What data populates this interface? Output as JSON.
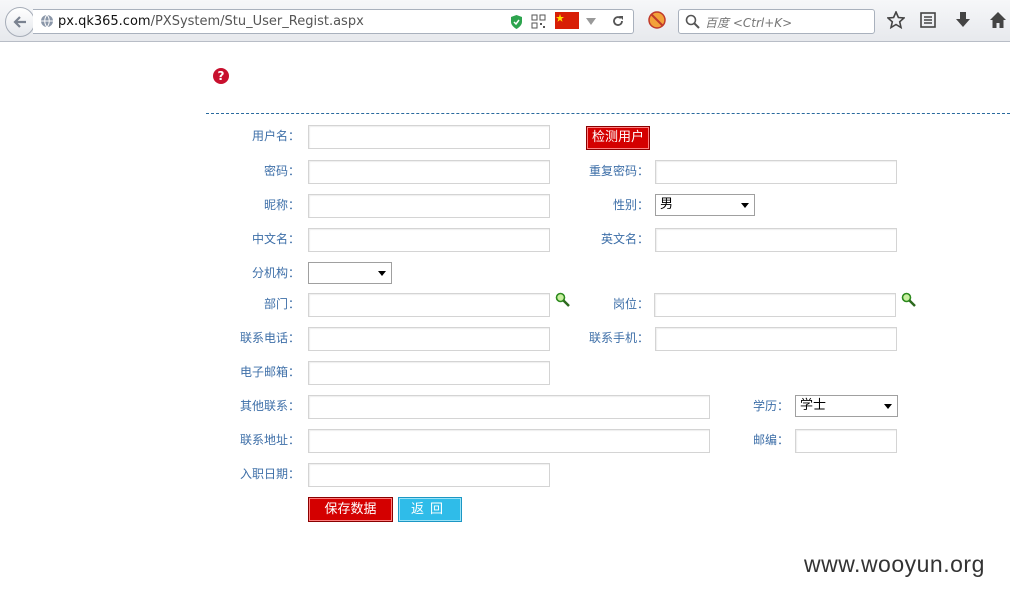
{
  "browser": {
    "url_host": "px.qk365.com",
    "url_path": "/PXSystem/Stu_User_Regist.aspx",
    "search_placeholder": "百度 <Ctrl+K>"
  },
  "form": {
    "username_label": "用户名：",
    "check_user_button": "检测用户",
    "password_label": "密码：",
    "confirm_password_label": "重复密码：",
    "nickname_label": "昵称：",
    "gender_label": "性别：",
    "gender_value": "男",
    "chinese_name_label": "中文名：",
    "english_name_label": "英文名：",
    "branch_label": "分机构：",
    "branch_value": "",
    "department_label": "部门：",
    "position_label": "岗位：",
    "phone_label": "联系电话：",
    "mobile_label": "联系手机：",
    "email_label": "电子邮箱：",
    "other_contact_label": "其他联系：",
    "education_label": "学历：",
    "education_value": "学士",
    "address_label": "联系地址：",
    "postcode_label": "邮编：",
    "hire_date_label": "入职日期：",
    "save_button": "保存数据",
    "back_button": "返回"
  },
  "watermark": "www.wooyun.org"
}
